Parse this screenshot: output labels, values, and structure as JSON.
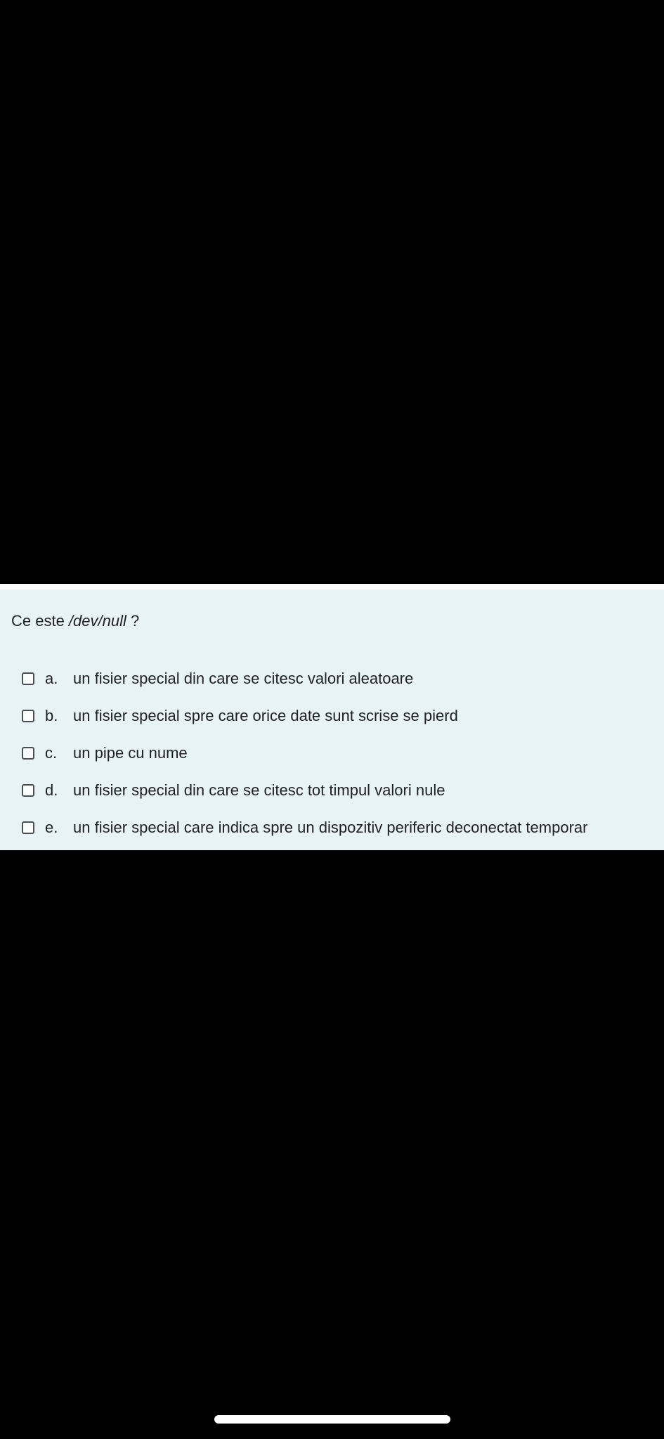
{
  "question": {
    "prefix": "Ce este ",
    "path": "/dev/null",
    "suffix": " ?"
  },
  "answers": [
    {
      "letter": "a.",
      "text": "un fisier special din care se citesc valori aleatoare",
      "checked": false
    },
    {
      "letter": "b.",
      "text": "un fisier special spre care orice date sunt scrise se pierd",
      "checked": false
    },
    {
      "letter": "c.",
      "text": "un pipe cu nume",
      "checked": false
    },
    {
      "letter": "d.",
      "text": "un fisier special din care se citesc tot timpul valori nule",
      "checked": false
    },
    {
      "letter": "e.",
      "text": "un fisier special care indica spre un dispozitiv periferic deconectat temporar",
      "checked": false
    }
  ],
  "colors": {
    "background": "#000000",
    "card": "#e7f3f5",
    "text": "#1d2125"
  }
}
